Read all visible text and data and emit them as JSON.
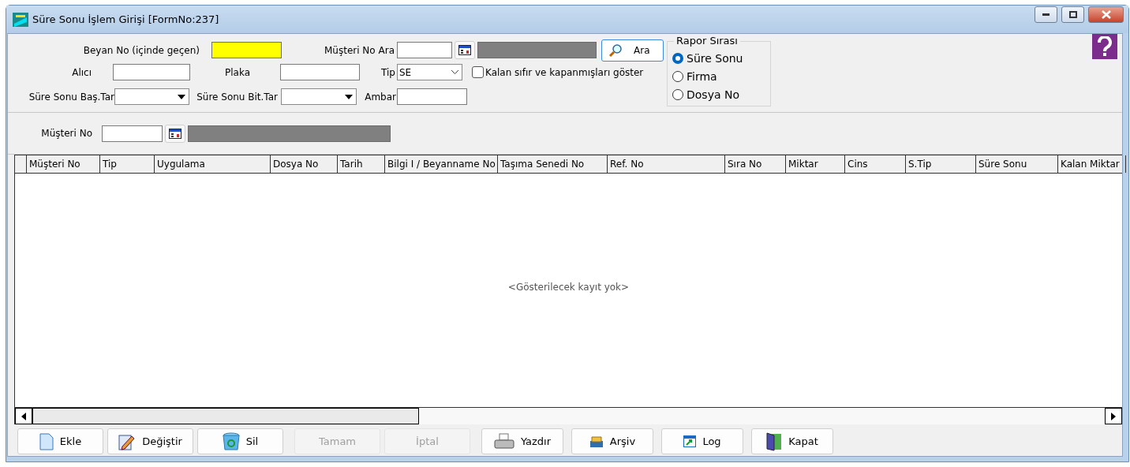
{
  "window": {
    "title": "Süre Sonu İşlem Girişi [FormNo:237]"
  },
  "filters": {
    "beyan_no": {
      "label": "Beyan No (içinde geçen)",
      "focused": true
    },
    "musteri_ara": {
      "label": "Müşteri No Ara",
      "button": "Ara"
    },
    "alici": {
      "label": "Alıcı",
      "focused": false
    },
    "plaka": {
      "label": "Plaka",
      "focused": false
    },
    "tip": {
      "label": "Tip",
      "value": "SE"
    },
    "show_closed": {
      "label": "Kalan sıfır ve kapanmışları göster",
      "checked": false
    },
    "bas_tar": {
      "label": "Süre Sonu Baş.Tar"
    },
    "bit_tar": {
      "label": "Süre Sonu Bit.Tar"
    },
    "ambar": {
      "label": "Ambar",
      "focused": false
    }
  },
  "report_order": {
    "title": "Rapor Sırası",
    "options": [
      {
        "label": "Süre Sonu",
        "selected": true
      },
      {
        "label": "Firma",
        "selected": false
      },
      {
        "label": "Dosya No",
        "selected": false
      }
    ]
  },
  "customer": {
    "label": "Müşteri No"
  },
  "table": {
    "columns": [
      "Müşteri No",
      "Tip",
      "Uygulama",
      "Dosya No",
      "Tarih",
      "Bilgi I / Beyanname No",
      "Taşıma Senedi No",
      "Ref. No",
      "Sıra No",
      "Miktar",
      "Cins",
      "S.Tip",
      "Süre Sonu",
      "Kalan Miktar"
    ],
    "empty_message": "<Gösterilecek kayıt yok>"
  },
  "buttons": [
    {
      "label": "Ekle",
      "kind": "new",
      "disabled": false
    },
    {
      "label": "Değiştir",
      "kind": "edit",
      "disabled": false
    },
    {
      "label": "Sil",
      "kind": "delete",
      "disabled": false
    },
    {
      "label": "Tamam",
      "kind": "ok",
      "disabled": true
    },
    {
      "label": "İptal",
      "kind": "cancel",
      "disabled": true
    },
    {
      "label": "Yazdır",
      "kind": "print",
      "disabled": false
    },
    {
      "label": "Arşiv",
      "kind": "archive",
      "disabled": false
    },
    {
      "label": "Log",
      "kind": "log",
      "disabled": false
    },
    {
      "label": "Kapat",
      "kind": "close",
      "disabled": false
    }
  ]
}
